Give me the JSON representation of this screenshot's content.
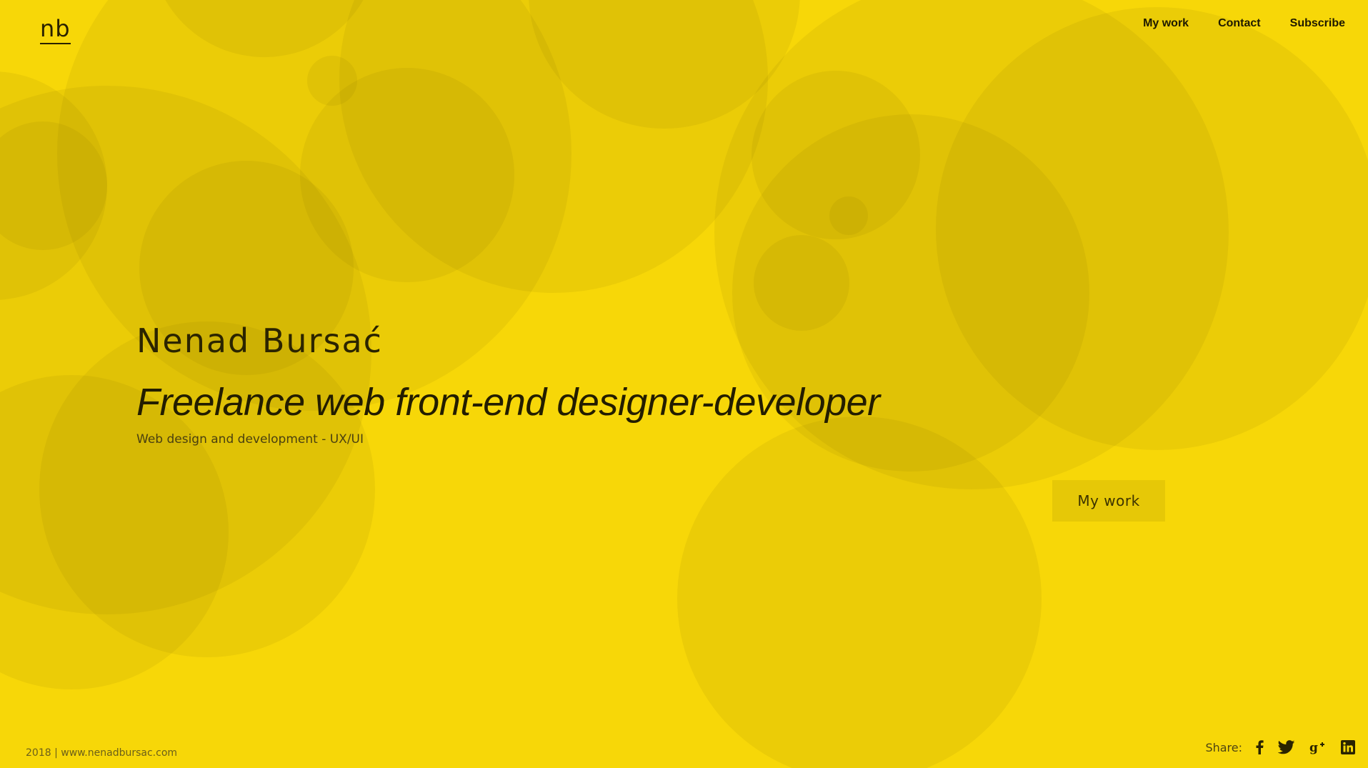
{
  "colors": {
    "background": "#f7d708",
    "bubble": "rgba(120,95,0,0.085)",
    "button_bg": "#e6c807",
    "text_dark": "#1f1a00"
  },
  "header": {
    "logo_text": "nb",
    "nav": [
      {
        "label": "My work"
      },
      {
        "label": "Contact"
      },
      {
        "label": "Subscribe"
      }
    ]
  },
  "hero": {
    "name": "Nenad Bursać",
    "tagline": "Freelance web front-end designer-developer",
    "subline": "Web design and development - UX/UI",
    "cta_label": "My work"
  },
  "footer": {
    "copyright": "2018 | www.nenadbursac.com",
    "share_label": "Share:",
    "share_icons": [
      "facebook-icon",
      "twitter-icon",
      "google-plus-icon",
      "linkedin-icon"
    ]
  }
}
